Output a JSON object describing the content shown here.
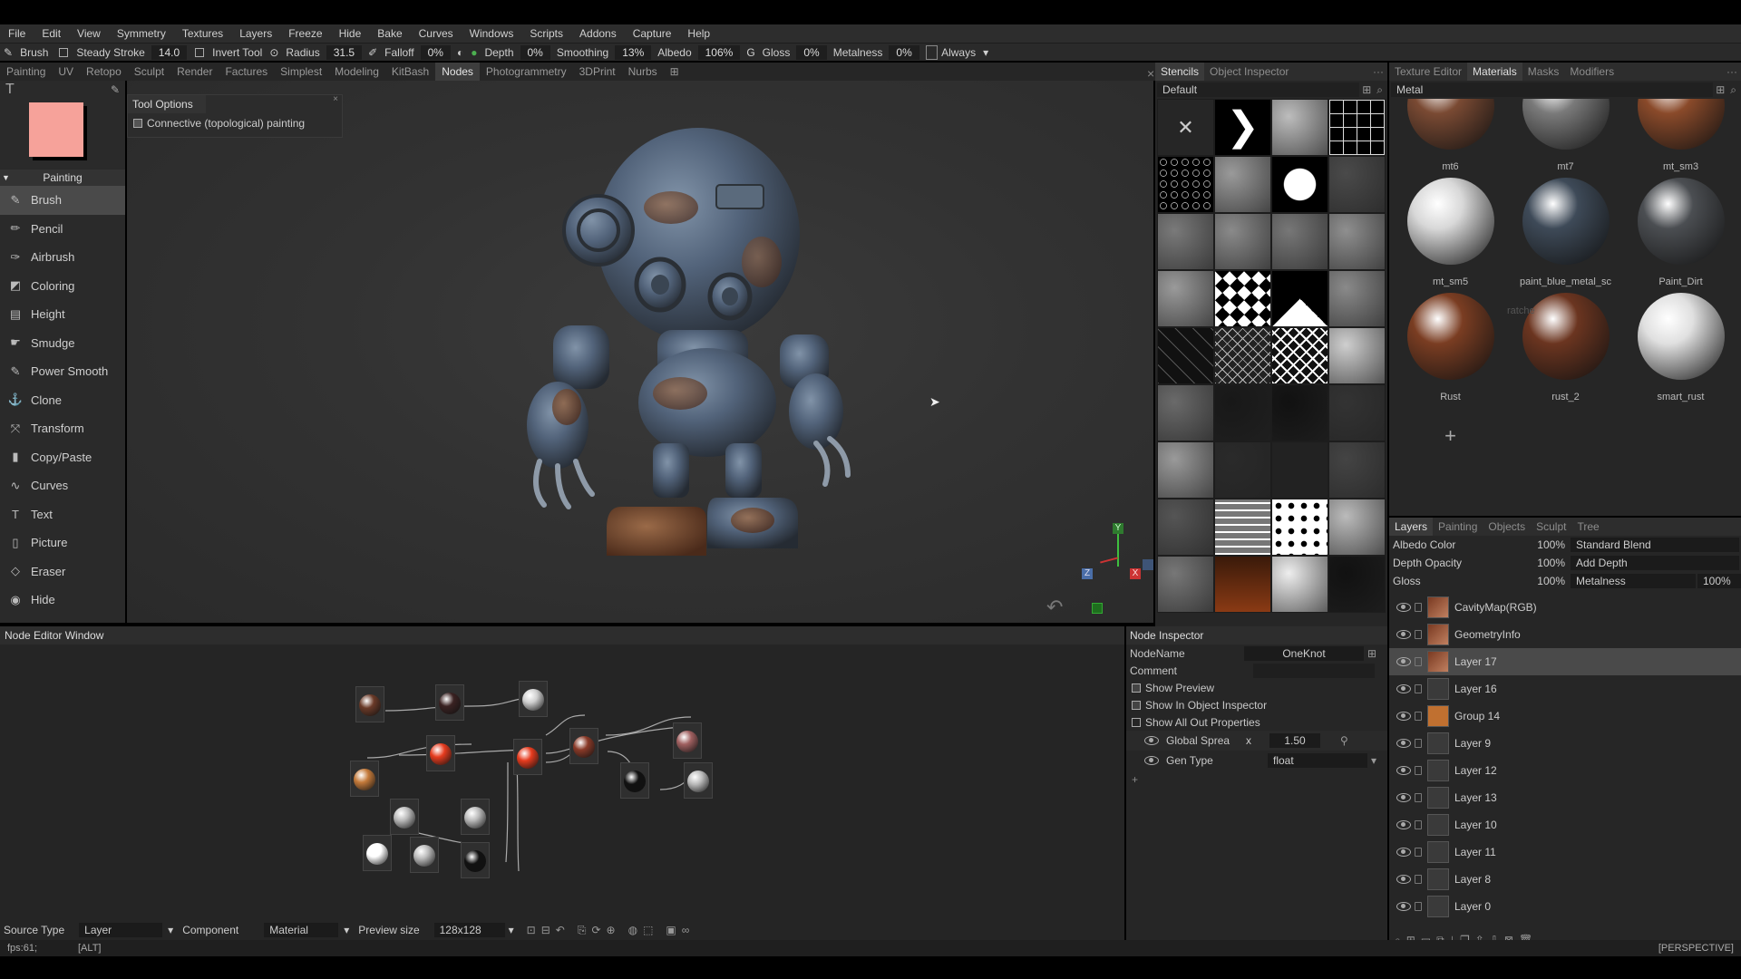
{
  "menu": [
    "File",
    "Edit",
    "View",
    "Symmetry",
    "Textures",
    "Layers",
    "Freeze",
    "Hide",
    "Bake",
    "Curves",
    "Windows",
    "Scripts",
    "Addons",
    "Capture",
    "Help"
  ],
  "menu_always": "Always",
  "toolbar": {
    "brush": "Brush",
    "steady_stroke": "Steady Stroke",
    "steady_value": "14.0",
    "invert_tool": "Invert Tool",
    "radius": "Radius",
    "radius_value": "31.5",
    "falloff": "Falloff",
    "falloff_value": "0%",
    "depth": "Depth",
    "depth_value": "0%",
    "smoothing": "Smoothing",
    "smoothing_value": "13%",
    "albedo": "Albedo",
    "albedo_value": "106%",
    "gloss_key": "G",
    "gloss": "Gloss",
    "gloss_value": "0%",
    "metalness": "Metalness",
    "metalness_value": "0%"
  },
  "rooms": [
    "Painting",
    "UV",
    "Retopo",
    "Sculpt",
    "Render",
    "Factures",
    "Simplest",
    "Modeling",
    "KitBash",
    "Nodes",
    "Photogrammetry",
    "3DPrint",
    "Nurbs"
  ],
  "active_room": "Nodes",
  "tool_options": {
    "title": "Tool Options",
    "connective": "Connective (topological) painting"
  },
  "color_swatch": "#f6a29a",
  "tool_section": "Painting",
  "tools": [
    "Brush",
    "Pencil",
    "Airbrush",
    "Coloring",
    "Height",
    "Smudge",
    "Power Smooth",
    "Clone",
    "Transform",
    "Copy/Paste",
    "Curves",
    "Text",
    "Picture",
    "Eraser",
    "Hide"
  ],
  "stencils": {
    "tab_stencils": "Stencils",
    "tab_object_inspector": "Object Inspector",
    "preset": "Default"
  },
  "materials": {
    "tabs": [
      "Texture Editor",
      "Materials",
      "Masks",
      "Modifiers"
    ],
    "active_tab": "Materials",
    "filter": "Metal",
    "items": [
      {
        "name": "mt6",
        "color": "#7a4a33"
      },
      {
        "name": "mt7",
        "color": "#7a7a7a"
      },
      {
        "name": "mt_sm3",
        "color": "#8a4a2a"
      },
      {
        "name": "mt_sm5",
        "color": "#d8d8d8"
      },
      {
        "name": "paint_blue_metal_sc",
        "color": "#3e4a58"
      },
      {
        "name": "Paint_Dirt",
        "color": "#4b4e52"
      },
      {
        "name": "Rust",
        "color": "#7a3d22"
      },
      {
        "name": "rust_2",
        "color": "#6b3520"
      },
      {
        "name": "smart_rust",
        "color": "#e0e0e0"
      }
    ],
    "ratchet_hint": "ratche"
  },
  "layers": {
    "tabs": [
      "Layers",
      "Painting",
      "Objects",
      "Sculpt",
      "Tree"
    ],
    "props": [
      {
        "label": "Albedo Color",
        "value": "100%",
        "blend": "Standard Blend"
      },
      {
        "label": "Depth Opacity",
        "value": "100%",
        "blend": "Add Depth"
      },
      {
        "label": "Gloss",
        "value": "100%",
        "blend": "Metalness",
        "blend_value": "100%"
      }
    ],
    "items": [
      {
        "name": "CavityMap(RGB)",
        "selected": false
      },
      {
        "name": "GeometryInfo",
        "selected": false
      },
      {
        "name": "Layer 17",
        "selected": true
      },
      {
        "name": "Layer 16",
        "selected": false
      },
      {
        "name": "Group 14",
        "selected": false
      },
      {
        "name": "Layer 9",
        "selected": false
      },
      {
        "name": "Layer 12",
        "selected": false
      },
      {
        "name": "Layer 13",
        "selected": false
      },
      {
        "name": "Layer 10",
        "selected": false
      },
      {
        "name": "Layer 11",
        "selected": false
      },
      {
        "name": "Layer 8",
        "selected": false
      },
      {
        "name": "Layer 0",
        "selected": false
      }
    ]
  },
  "node_editor": {
    "title": "Node Editor Window",
    "source_type_label": "Source Type",
    "source_type_value": "Layer",
    "component_label": "Component",
    "component_value": "Material",
    "preview_size_label": "Preview size",
    "preview_size_value": "128x128"
  },
  "node_inspector": {
    "title": "Node Inspector",
    "node_name_label": "NodeName",
    "node_name_value": "OneKnot",
    "comment_label": "Comment",
    "show_preview": "Show Preview",
    "show_in_object_inspector": "Show In Object Inspector",
    "show_all_out": "Show All Out Properties",
    "global_spread": "Global Sprea",
    "global_spread_axis": "x",
    "global_spread_value": "1.50",
    "gen_type": "Gen Type",
    "gen_type_value": "float"
  },
  "status": {
    "fps": "fps:61;",
    "key": "[ALT]",
    "view": "[PERSPECTIVE]"
  },
  "gizmo": {
    "y": "Y",
    "z": "Z",
    "x": "X"
  }
}
